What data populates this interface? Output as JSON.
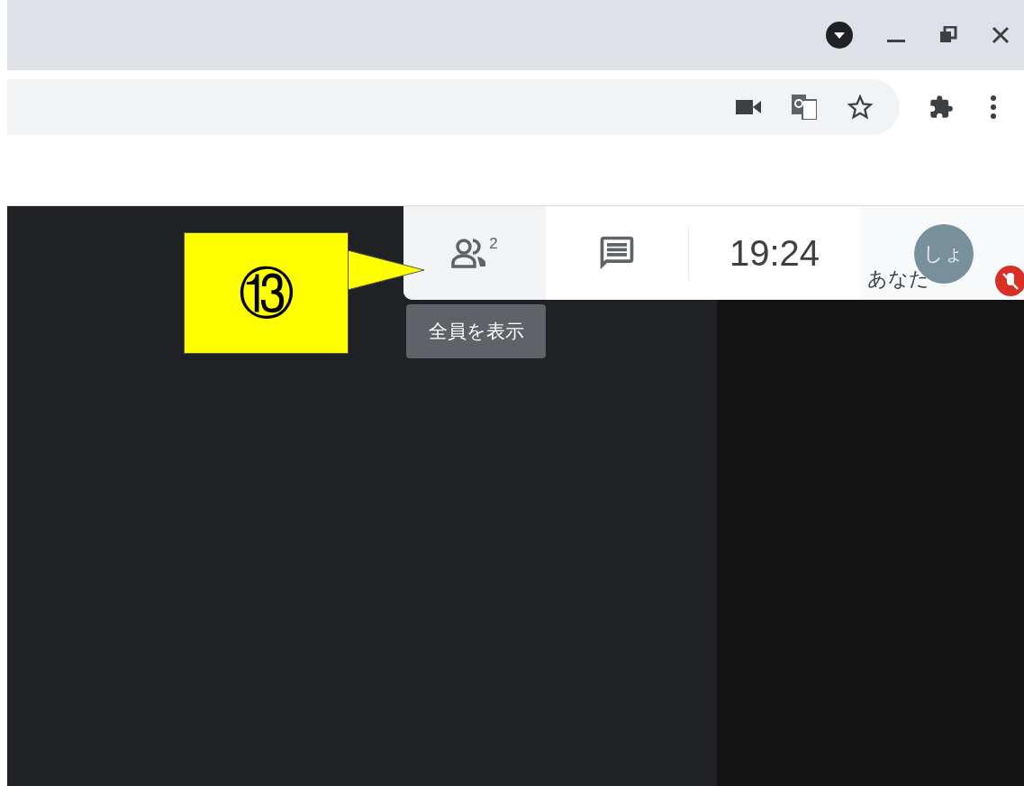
{
  "callout": {
    "label": "⑬"
  },
  "meeting_bar": {
    "participants_count": "2",
    "time": "19:24",
    "self": {
      "initials": "しょ",
      "name": "あなた",
      "muted": true
    }
  },
  "tooltip": {
    "text": "全員を表示"
  }
}
